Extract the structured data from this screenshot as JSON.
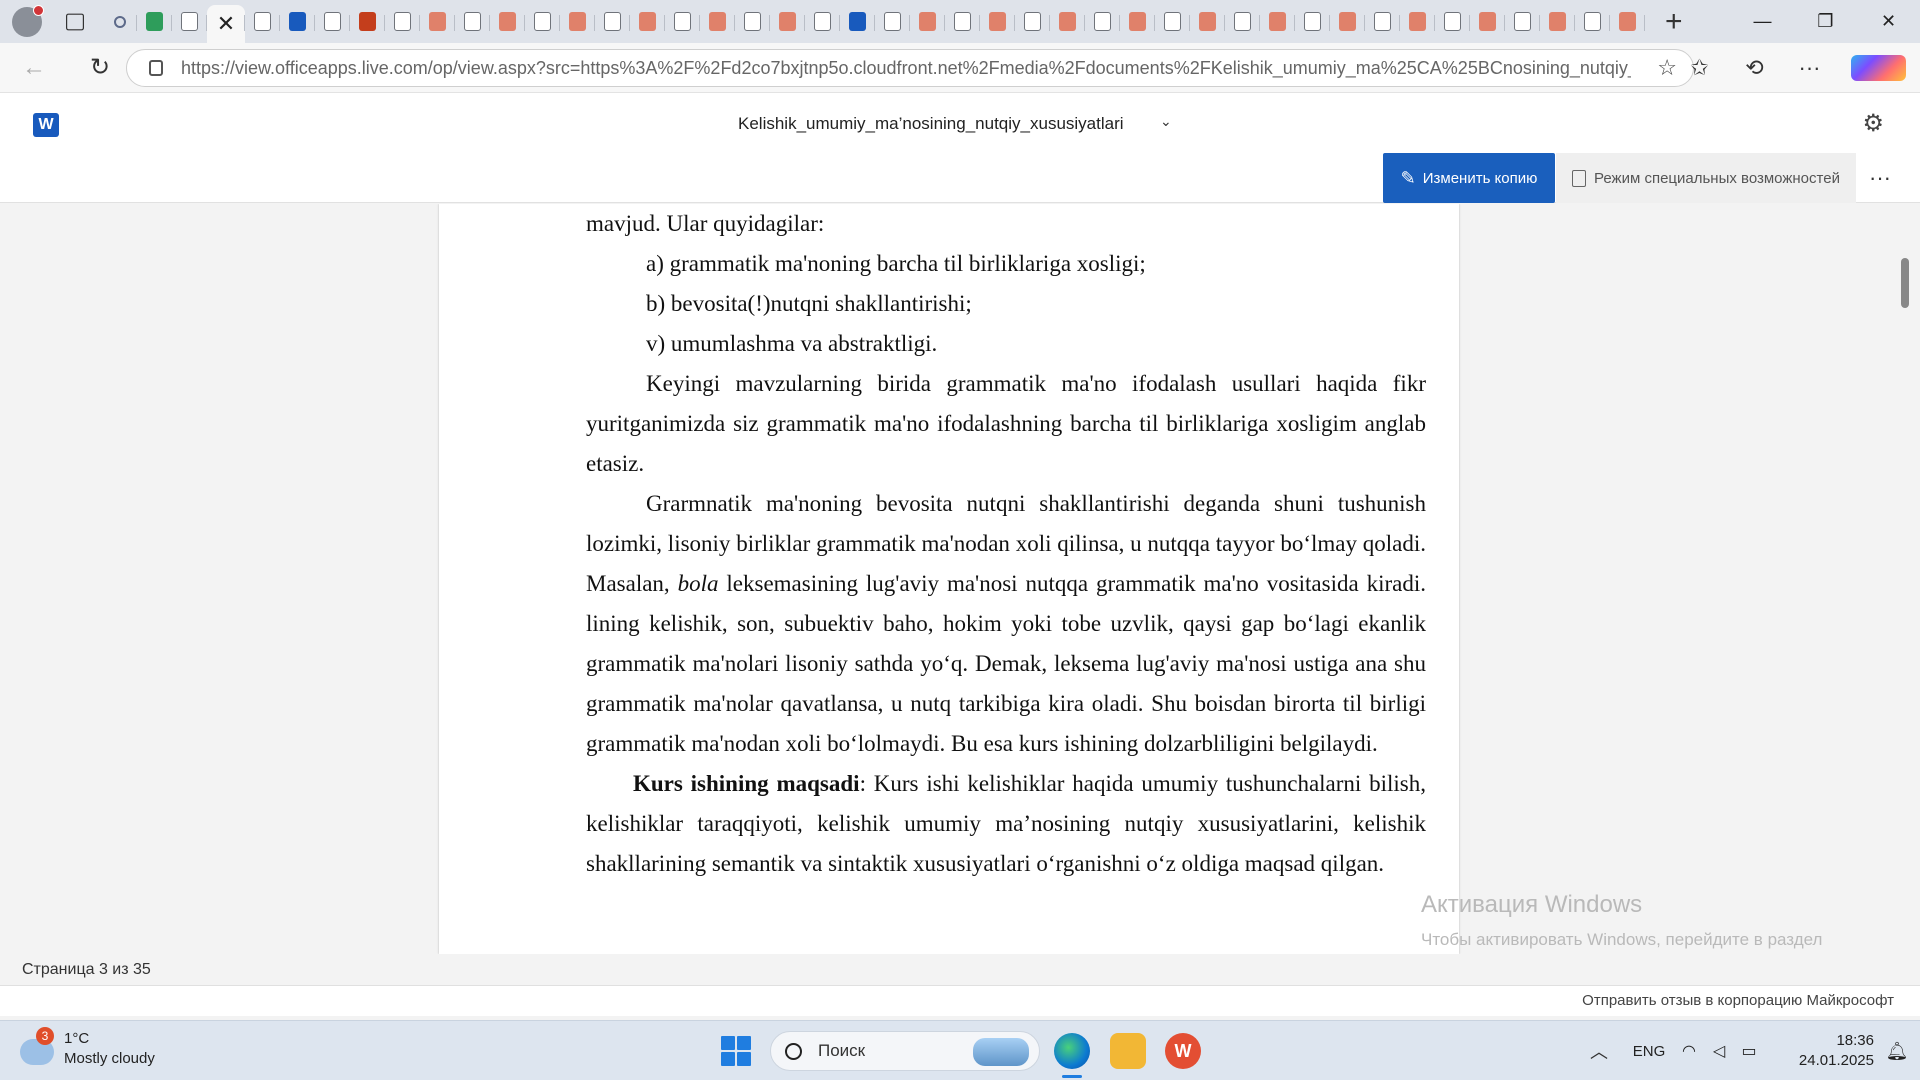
{
  "browser": {
    "tabs": [
      {
        "icon": "search-favicon"
      },
      {
        "icon": "green-app-favicon"
      },
      {
        "icon": "document-favicon"
      },
      {
        "icon": "active",
        "close": "✕"
      },
      {
        "icon": "document-favicon"
      },
      {
        "icon": "word-favicon"
      },
      {
        "icon": "document-favicon"
      },
      {
        "icon": "powerpoint-favicon"
      },
      {
        "icon": "document-favicon"
      },
      {
        "icon": "powerpoint-light-favicon"
      },
      {
        "icon": "document-favicon"
      },
      {
        "icon": "powerpoint-light-favicon"
      },
      {
        "icon": "document-favicon"
      },
      {
        "icon": "powerpoint-light-favicon"
      },
      {
        "icon": "document-favicon"
      },
      {
        "icon": "powerpoint-light-favicon"
      },
      {
        "icon": "document-favicon"
      },
      {
        "icon": "powerpoint-light-favicon"
      },
      {
        "icon": "document-favicon"
      },
      {
        "icon": "powerpoint-light-favicon"
      },
      {
        "icon": "document-favicon"
      },
      {
        "icon": "word-favicon"
      },
      {
        "icon": "document-favicon"
      },
      {
        "icon": "powerpoint-light-favicon"
      },
      {
        "icon": "document-favicon"
      },
      {
        "icon": "powerpoint-light-favicon"
      },
      {
        "icon": "document-favicon"
      },
      {
        "icon": "powerpoint-light-favicon"
      },
      {
        "icon": "document-favicon"
      },
      {
        "icon": "powerpoint-light-favicon"
      },
      {
        "icon": "document-favicon"
      },
      {
        "icon": "powerpoint-light-favicon"
      },
      {
        "icon": "document-favicon"
      },
      {
        "icon": "powerpoint-light-favicon"
      },
      {
        "icon": "document-favicon"
      },
      {
        "icon": "powerpoint-light-favicon"
      },
      {
        "icon": "document-favicon"
      },
      {
        "icon": "powerpoint-light-favicon"
      },
      {
        "icon": "document-favicon"
      },
      {
        "icon": "powerpoint-light-favicon"
      },
      {
        "icon": "document-favicon"
      },
      {
        "icon": "powerpoint-light-favicon"
      },
      {
        "icon": "document-favicon"
      },
      {
        "icon": "powerpoint-light-favicon"
      },
      {
        "icon": "document-favicon"
      },
      {
        "icon": "word-favicon"
      }
    ],
    "url": "https://view.officeapps.live.com/op/view.aspx?src=https%3A%2F%2Fd2co7bxjtnp5o.cloudfront.net%2Fmedia%2Fdocuments%2FKelishik_umumiy_ma%25CA%25BCnosining_nutqiy_xusus...",
    "new_tab": "+",
    "window_controls": {
      "minimize": "—",
      "maximize": "❐",
      "close": "✕"
    }
  },
  "app": {
    "logo": "W",
    "doc_title": "Kelishik_umumiy_ma’nosining_nutqiy_xususiyatlari",
    "edit_copy_label": "Изменить копию",
    "accessibility_label": "Режим специальных возможностей",
    "more": "···"
  },
  "document": {
    "p1": "mavjud. Ular quyidagilar:",
    "list_a": "a) grammatik ma'noning barcha til birliklariga xosligi;",
    "list_b": "b) bevosita(!)nutqni shakllantirishi;",
    "list_v": "v) umumlashma va abstraktligi.",
    "p2": "Keyingi mavzularning birida grammatik ma'no ifodalash usullari haqida fikr yuritganimizda siz grammatik ma'no ifodalashning barcha til birliklariga xosligim anglab etasiz.",
    "p3_before": "Grarmnatik ma'noning bevosita nutqni shakllantirishi deganda shuni tushunish lozimki, lisoniy birliklar grammatik ma'nodan xoli qilinsa, u nutqqa tayyor bo‘lmay qoladi. Masalan, ",
    "p3_italic": "bola",
    "p3_after": " leksemasining lug'aviy ma'nosi nutqqa grammatik ma'no vositasida kiradi. lining kelishik, son, subuektiv baho, hokim yoki tobe uzvlik, qaysi gap bo‘lagi ekanlik grammatik ma'nolari lisoniy sathda yo‘q. Demak, leksema lug'aviy ma'nosi ustiga ana shu grammatik ma'nolar qavatlansa, u nutq tarkibiga kira oladi. Shu boisdan birorta til birligi grammatik ma'nodan xoli bo‘lolmaydi. Bu esa kurs ishining dolzarbliligini belgilaydi.",
    "p4_bold": "Kurs ishining maqsadi",
    "p4_rest": ": Kurs ishi  kelishiklar haqida umumiy tushunchalarni bilish, kelishiklar taraqqiyoti, kelishik umumiy ma’nosining nutqiy xususiyatlarini, kelishik shakllarining semantik va sintaktik xususiyatlari o‘rganishni o‘z oldiga maqsad qilgan."
  },
  "activation": {
    "title": "Активация Windows",
    "subtitle": "Чтобы активировать Windows, перейдите в раздел \"Параметры\"."
  },
  "status": {
    "page_indicator": "Страница 3 из 35",
    "feedback": "Отправить отзыв в корпорацию Майкрософт"
  },
  "taskbar": {
    "weather_badge": "3",
    "temperature": "1°C",
    "condition": "Mostly cloudy",
    "search_placeholder": "Поиск",
    "wps_label": "W",
    "lang": "ENG",
    "time": "18:36",
    "date": "24.01.2025"
  },
  "colors": {
    "accent": "#1a5fbd",
    "word_brand": "#185abd"
  }
}
